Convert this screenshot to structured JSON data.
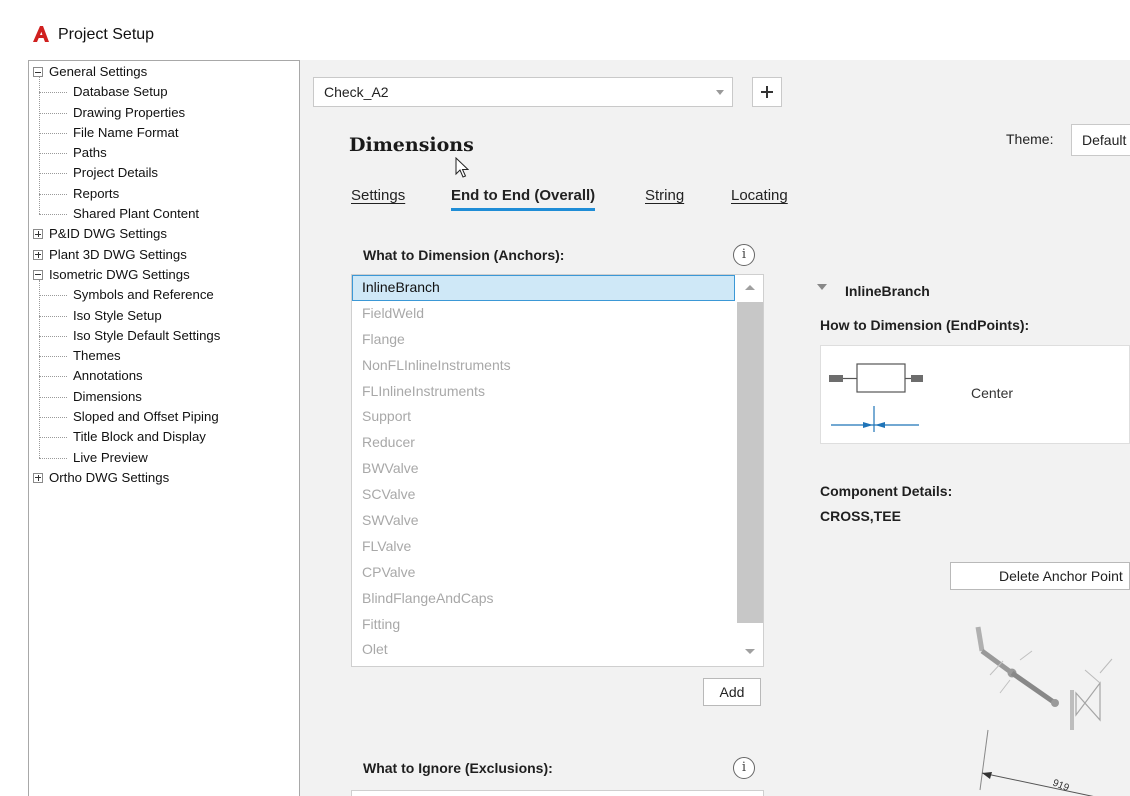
{
  "window": {
    "title": "Project Setup",
    "logo_icon": "autocad-a-icon"
  },
  "tree": {
    "nodes": [
      {
        "label": "General Settings",
        "level": 0,
        "expander": "minus"
      },
      {
        "label": "Database Setup",
        "level": 1
      },
      {
        "label": "Drawing Properties",
        "level": 1
      },
      {
        "label": "File Name Format",
        "level": 1
      },
      {
        "label": "Paths",
        "level": 1
      },
      {
        "label": "Project Details",
        "level": 1
      },
      {
        "label": "Reports",
        "level": 1
      },
      {
        "label": "Shared Plant Content",
        "level": 1
      },
      {
        "label": "P&ID DWG Settings",
        "level": 0,
        "expander": "plus"
      },
      {
        "label": "Plant 3D DWG Settings",
        "level": 0,
        "expander": "plus"
      },
      {
        "label": "Isometric DWG Settings",
        "level": 0,
        "expander": "minus"
      },
      {
        "label": "Symbols and Reference",
        "level": 1
      },
      {
        "label": "Iso Style Setup",
        "level": 1
      },
      {
        "label": "Iso Style Default Settings",
        "level": 1
      },
      {
        "label": "Themes",
        "level": 1
      },
      {
        "label": "Annotations",
        "level": 1
      },
      {
        "label": "Dimensions",
        "level": 1
      },
      {
        "label": "Sloped and Offset Piping",
        "level": 1
      },
      {
        "label": "Title Block and Display",
        "level": 1
      },
      {
        "label": "Live Preview",
        "level": 1
      },
      {
        "label": "Ortho DWG Settings",
        "level": 0,
        "expander": "plus"
      }
    ]
  },
  "style_combo": {
    "value": "Check_A2"
  },
  "section": {
    "title": "Dimensions"
  },
  "theme": {
    "label": "Theme:",
    "value": "Default"
  },
  "tabs": [
    {
      "label": "Settings",
      "active": false
    },
    {
      "label": "End to End (Overall)",
      "active": true
    },
    {
      "label": "String",
      "active": false
    },
    {
      "label": "Locating",
      "active": false
    }
  ],
  "anchors": {
    "heading": "What to Dimension (Anchors):",
    "items": [
      "InlineBranch",
      "FieldWeld",
      "Flange",
      "NonFLInlineInstruments",
      "FLInlineInstruments",
      "Support",
      "Reducer",
      "BWValve",
      "SCValve",
      "SWValve",
      "FLValve",
      "CPValve",
      "BlindFlangeAndCaps",
      "Fitting",
      "Olet"
    ],
    "selected_index": 0,
    "add_label": "Add"
  },
  "exclusions": {
    "heading": "What to Ignore (Exclusions):"
  },
  "details": {
    "anchor_name": "InlineBranch",
    "how_heading": "How to Dimension (EndPoints):",
    "endpoint_option": "Center",
    "component_heading": "Component Details:",
    "component_value": "CROSS,TEE",
    "delete_label": "Delete Anchor Point",
    "preview_dimension": "919"
  },
  "colors": {
    "accent": "#1f8dd6",
    "selection_bg": "#cfe8f7",
    "panel_bg": "#f2f2f2"
  }
}
